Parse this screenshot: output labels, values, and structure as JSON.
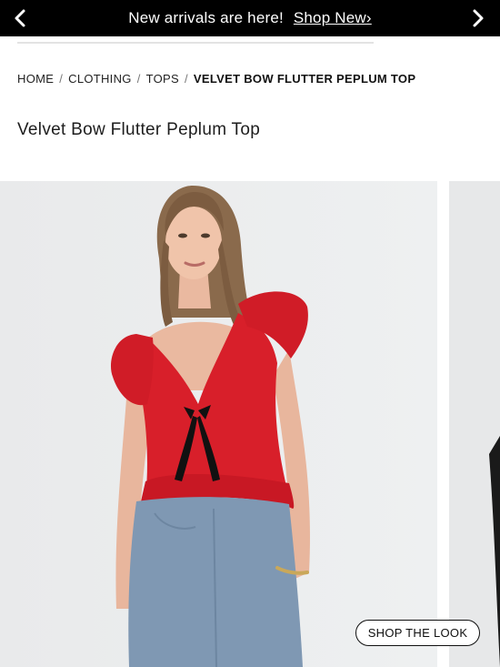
{
  "promo": {
    "message": "New arrivals are here!",
    "link_label": "Shop New›",
    "prev_icon": "chevron-left-icon",
    "next_icon": "chevron-right-icon"
  },
  "breadcrumb": {
    "items": [
      "HOME",
      "CLOTHING",
      "TOPS"
    ],
    "current": "VELVET BOW FLUTTER PEPLUM TOP",
    "separator": "/"
  },
  "product": {
    "title": "Velvet Bow Flutter Peplum Top"
  },
  "gallery": {
    "shop_the_look_label": "SHOP THE LOOK"
  },
  "colors": {
    "promo_bg": "#000000",
    "top_red": "#d81f2a",
    "bow_black": "#111111",
    "jeans_blue": "#7f98b3",
    "image_bg": "#ebeced"
  }
}
